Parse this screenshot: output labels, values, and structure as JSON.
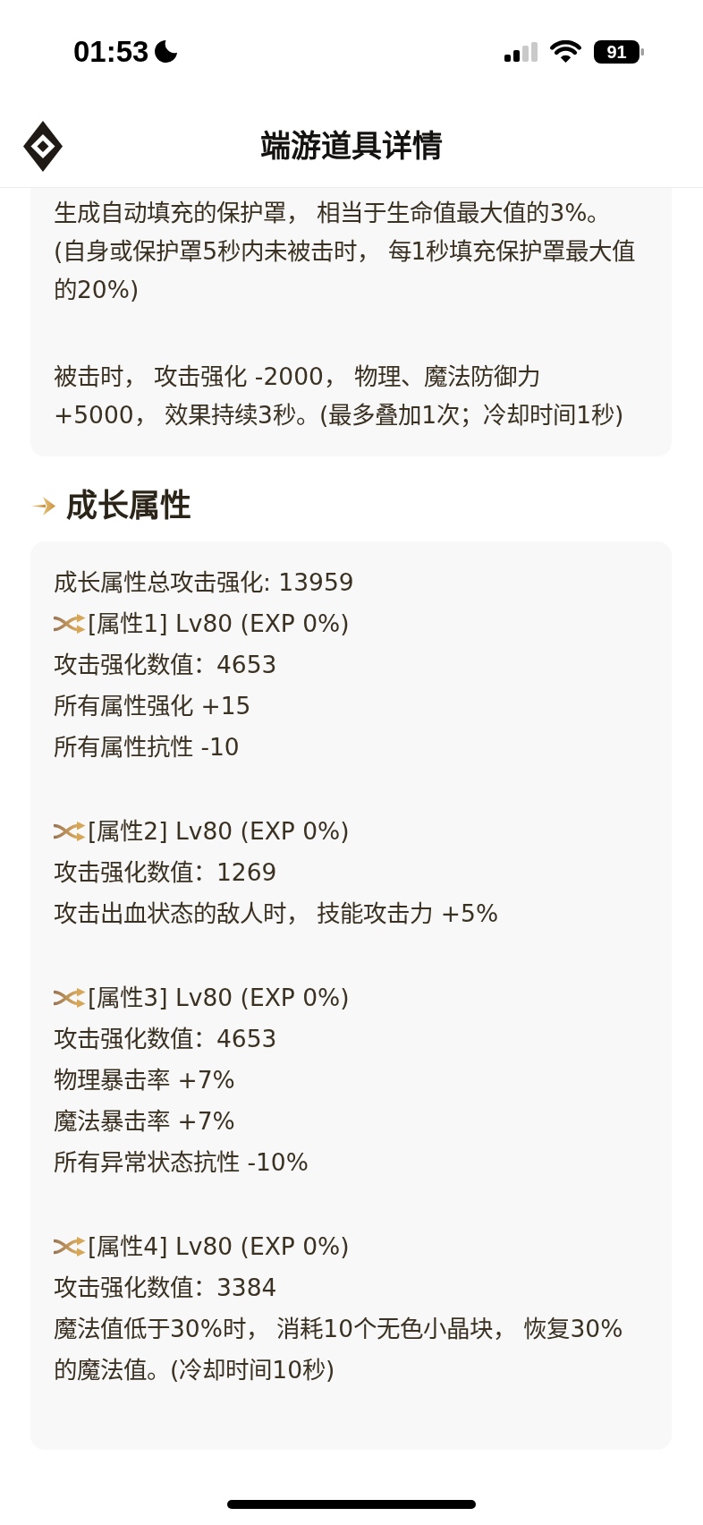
{
  "status_bar": {
    "time": "01:53",
    "battery": "91"
  },
  "header": {
    "title": "端游道具详情"
  },
  "effect_card": {
    "blocks": [
      [
        "生成自动填充的保护罩， 相当于生命值最大值的3%。",
        "(自身或保护罩5秒内未被击时， 每1秒填充保护罩最大值的20%)"
      ],
      [
        "被击时， 攻击强化 -2000， 物理、魔法防御力 +5000， 效果持续3秒。(最多叠加1次；冷却时间1秒)"
      ]
    ]
  },
  "growth_section": {
    "title": "成长属性",
    "summary": "成长属性总攻击强化: 13959",
    "attributes": [
      {
        "title": "[属性1] Lv80 (EXP 0%)",
        "lines": [
          "攻击强化数值：4653",
          "所有属性强化 +15",
          "所有属性抗性 -10"
        ]
      },
      {
        "title": "[属性2] Lv80 (EXP 0%)",
        "lines": [
          "攻击强化数值：1269",
          "攻击出血状态的敌人时， 技能攻击力 +5%"
        ]
      },
      {
        "title": "[属性3] Lv80 (EXP 0%)",
        "lines": [
          "攻击强化数值：4653",
          "物理暴击率 +7%",
          "魔法暴击率 +7%",
          "所有异常状态抗性 -10%"
        ]
      },
      {
        "title": "[属性4] Lv80 (EXP 0%)",
        "lines": [
          "攻击强化数值：3384",
          "魔法值低于30%时， 消耗10个无色小晶块， 恢复30%的魔法值。(冷却时间10秒)"
        ]
      }
    ]
  }
}
